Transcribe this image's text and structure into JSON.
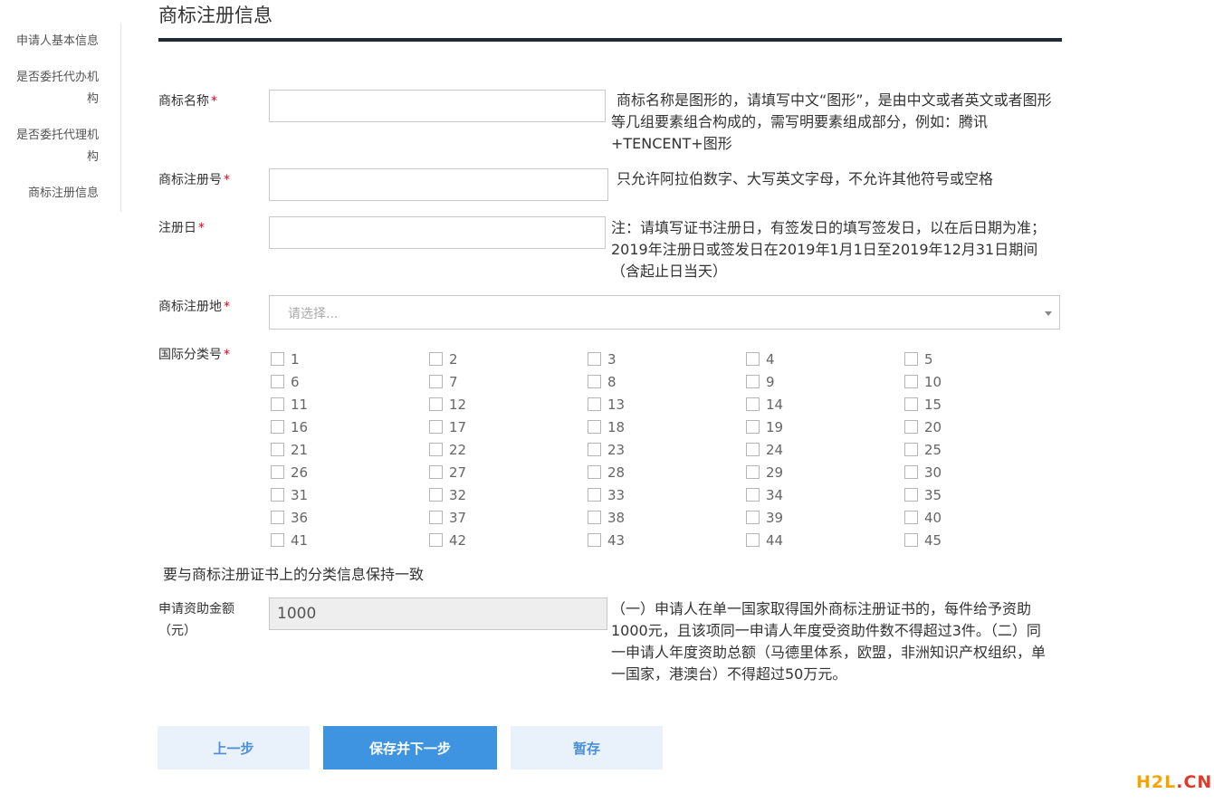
{
  "sidebar": {
    "items": [
      {
        "label": "申请人基本信息"
      },
      {
        "label": "是否委托代办机",
        "label2": "构"
      },
      {
        "label": "是否委托代理机",
        "label2": "构"
      },
      {
        "label": "商标注册信息"
      }
    ]
  },
  "header": {
    "title": "商标注册信息"
  },
  "form": {
    "required_mark": "*",
    "name": {
      "label": "商标名称",
      "value": "",
      "help": "商标名称是图形的，请填写中文“图形”，是由中文或者英文或者图形等几组要素组合构成的，需写明要素组成部分，例如：腾讯+TENCENT+图形"
    },
    "reg_no": {
      "label": "商标注册号",
      "value": "",
      "help": "只允许阿拉伯数字、大写英文字母，不允许其他符号或空格"
    },
    "reg_date": {
      "label": "注册日",
      "value": "",
      "help": "注：请填写证书注册日，有签发日的填写签发日，以在后日期为准；2019年注册日或签发日在2019年1月1日至2019年12月31日期间（含起止日当天）"
    },
    "reg_place": {
      "label": "商标注册地",
      "placeholder": "请选择..."
    },
    "intl_class": {
      "label": "国际分类号",
      "options": [
        "1",
        "2",
        "3",
        "4",
        "5",
        "6",
        "7",
        "8",
        "9",
        "10",
        "11",
        "12",
        "13",
        "14",
        "15",
        "16",
        "17",
        "18",
        "19",
        "20",
        "21",
        "22",
        "23",
        "24",
        "25",
        "26",
        "27",
        "28",
        "29",
        "30",
        "31",
        "32",
        "33",
        "34",
        "35",
        "36",
        "37",
        "38",
        "39",
        "40",
        "41",
        "42",
        "43",
        "44",
        "45"
      ],
      "note": "要与商标注册证书上的分类信息保持一致"
    },
    "amount": {
      "label": "申请资助金额",
      "label2": "（元）",
      "value": "1000",
      "help": "（一）申请人在单一国家取得国外商标注册证书的，每件给予资助1000元，且该项同一申请人年度受资助件数不得超过3件。（二）同一申请人年度资助总额（马德里体系，欧盟，非洲知识产权组织，单一国家，港澳台）不得超过50万元。"
    }
  },
  "buttons": {
    "prev": "上一步",
    "save_next": "保存并下一步",
    "temp_save": "暂存"
  },
  "watermark": {
    "part1": "H2L",
    "part2": ".CN"
  }
}
